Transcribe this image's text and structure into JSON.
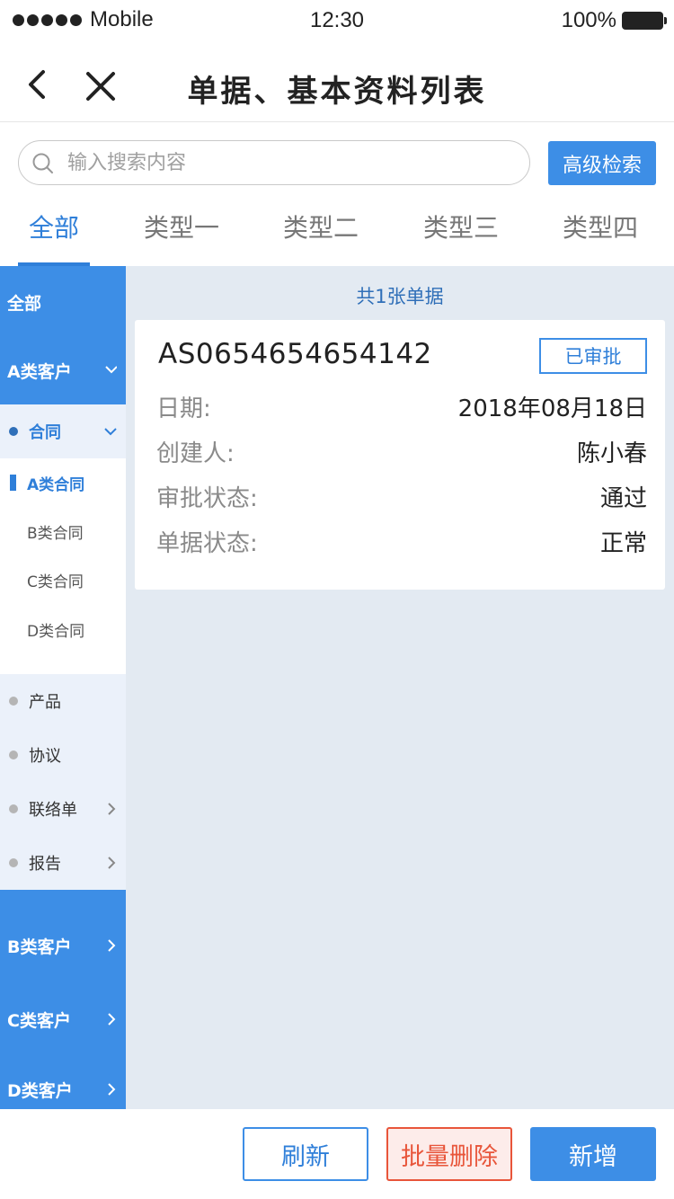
{
  "status_bar": {
    "carrier": "Mobile",
    "time": "12:30",
    "battery": "100%"
  },
  "nav": {
    "title": "单据、基本资料列表",
    "back_icon": "chevron-left-icon",
    "close_icon": "close-icon"
  },
  "search": {
    "placeholder": "输入搜索内容",
    "value": "",
    "advanced_label": "高级检索"
  },
  "tabs": [
    {
      "label": "全部",
      "active": true
    },
    {
      "label": "类型一",
      "active": false
    },
    {
      "label": "类型二",
      "active": false
    },
    {
      "label": "类型三",
      "active": false
    },
    {
      "label": "类型四",
      "active": false
    }
  ],
  "sidebar": {
    "all_label": "全部",
    "customers": [
      {
        "label": "A类客户",
        "expanded": true
      },
      {
        "label": "B类客户",
        "expanded": false
      },
      {
        "label": "C类客户",
        "expanded": false
      },
      {
        "label": "D类客户",
        "expanded": false
      }
    ],
    "subgroups": [
      {
        "label": "合同",
        "expanded": true
      },
      {
        "label": "产品"
      },
      {
        "label": "协议"
      },
      {
        "label": "联络单",
        "has_children": true
      },
      {
        "label": "报告",
        "has_children": true
      }
    ],
    "contract_items": [
      {
        "label": "A类合同",
        "active": true
      },
      {
        "label": "B类合同",
        "active": false
      },
      {
        "label": "C类合同",
        "active": false
      },
      {
        "label": "D类合同",
        "active": false
      }
    ]
  },
  "results": {
    "count_text": "共1张单据",
    "cards": [
      {
        "number": "AS0654654654142",
        "status_badge": "已审批",
        "fields": [
          {
            "label": "日期:",
            "value": "2018年08月18日"
          },
          {
            "label": "创建人:",
            "value": "陈小春"
          },
          {
            "label": "审批状态:",
            "value": "通过"
          },
          {
            "label": "单据状态:",
            "value": "正常"
          }
        ]
      }
    ]
  },
  "actions": {
    "refresh": "刷新",
    "batch_delete": "批量删除",
    "add": "新增"
  },
  "colors": {
    "accent": "#3d8ee6",
    "danger": "#e8553a",
    "content_bg": "#e3eaf2",
    "sub_bg": "#ebf1fa"
  }
}
